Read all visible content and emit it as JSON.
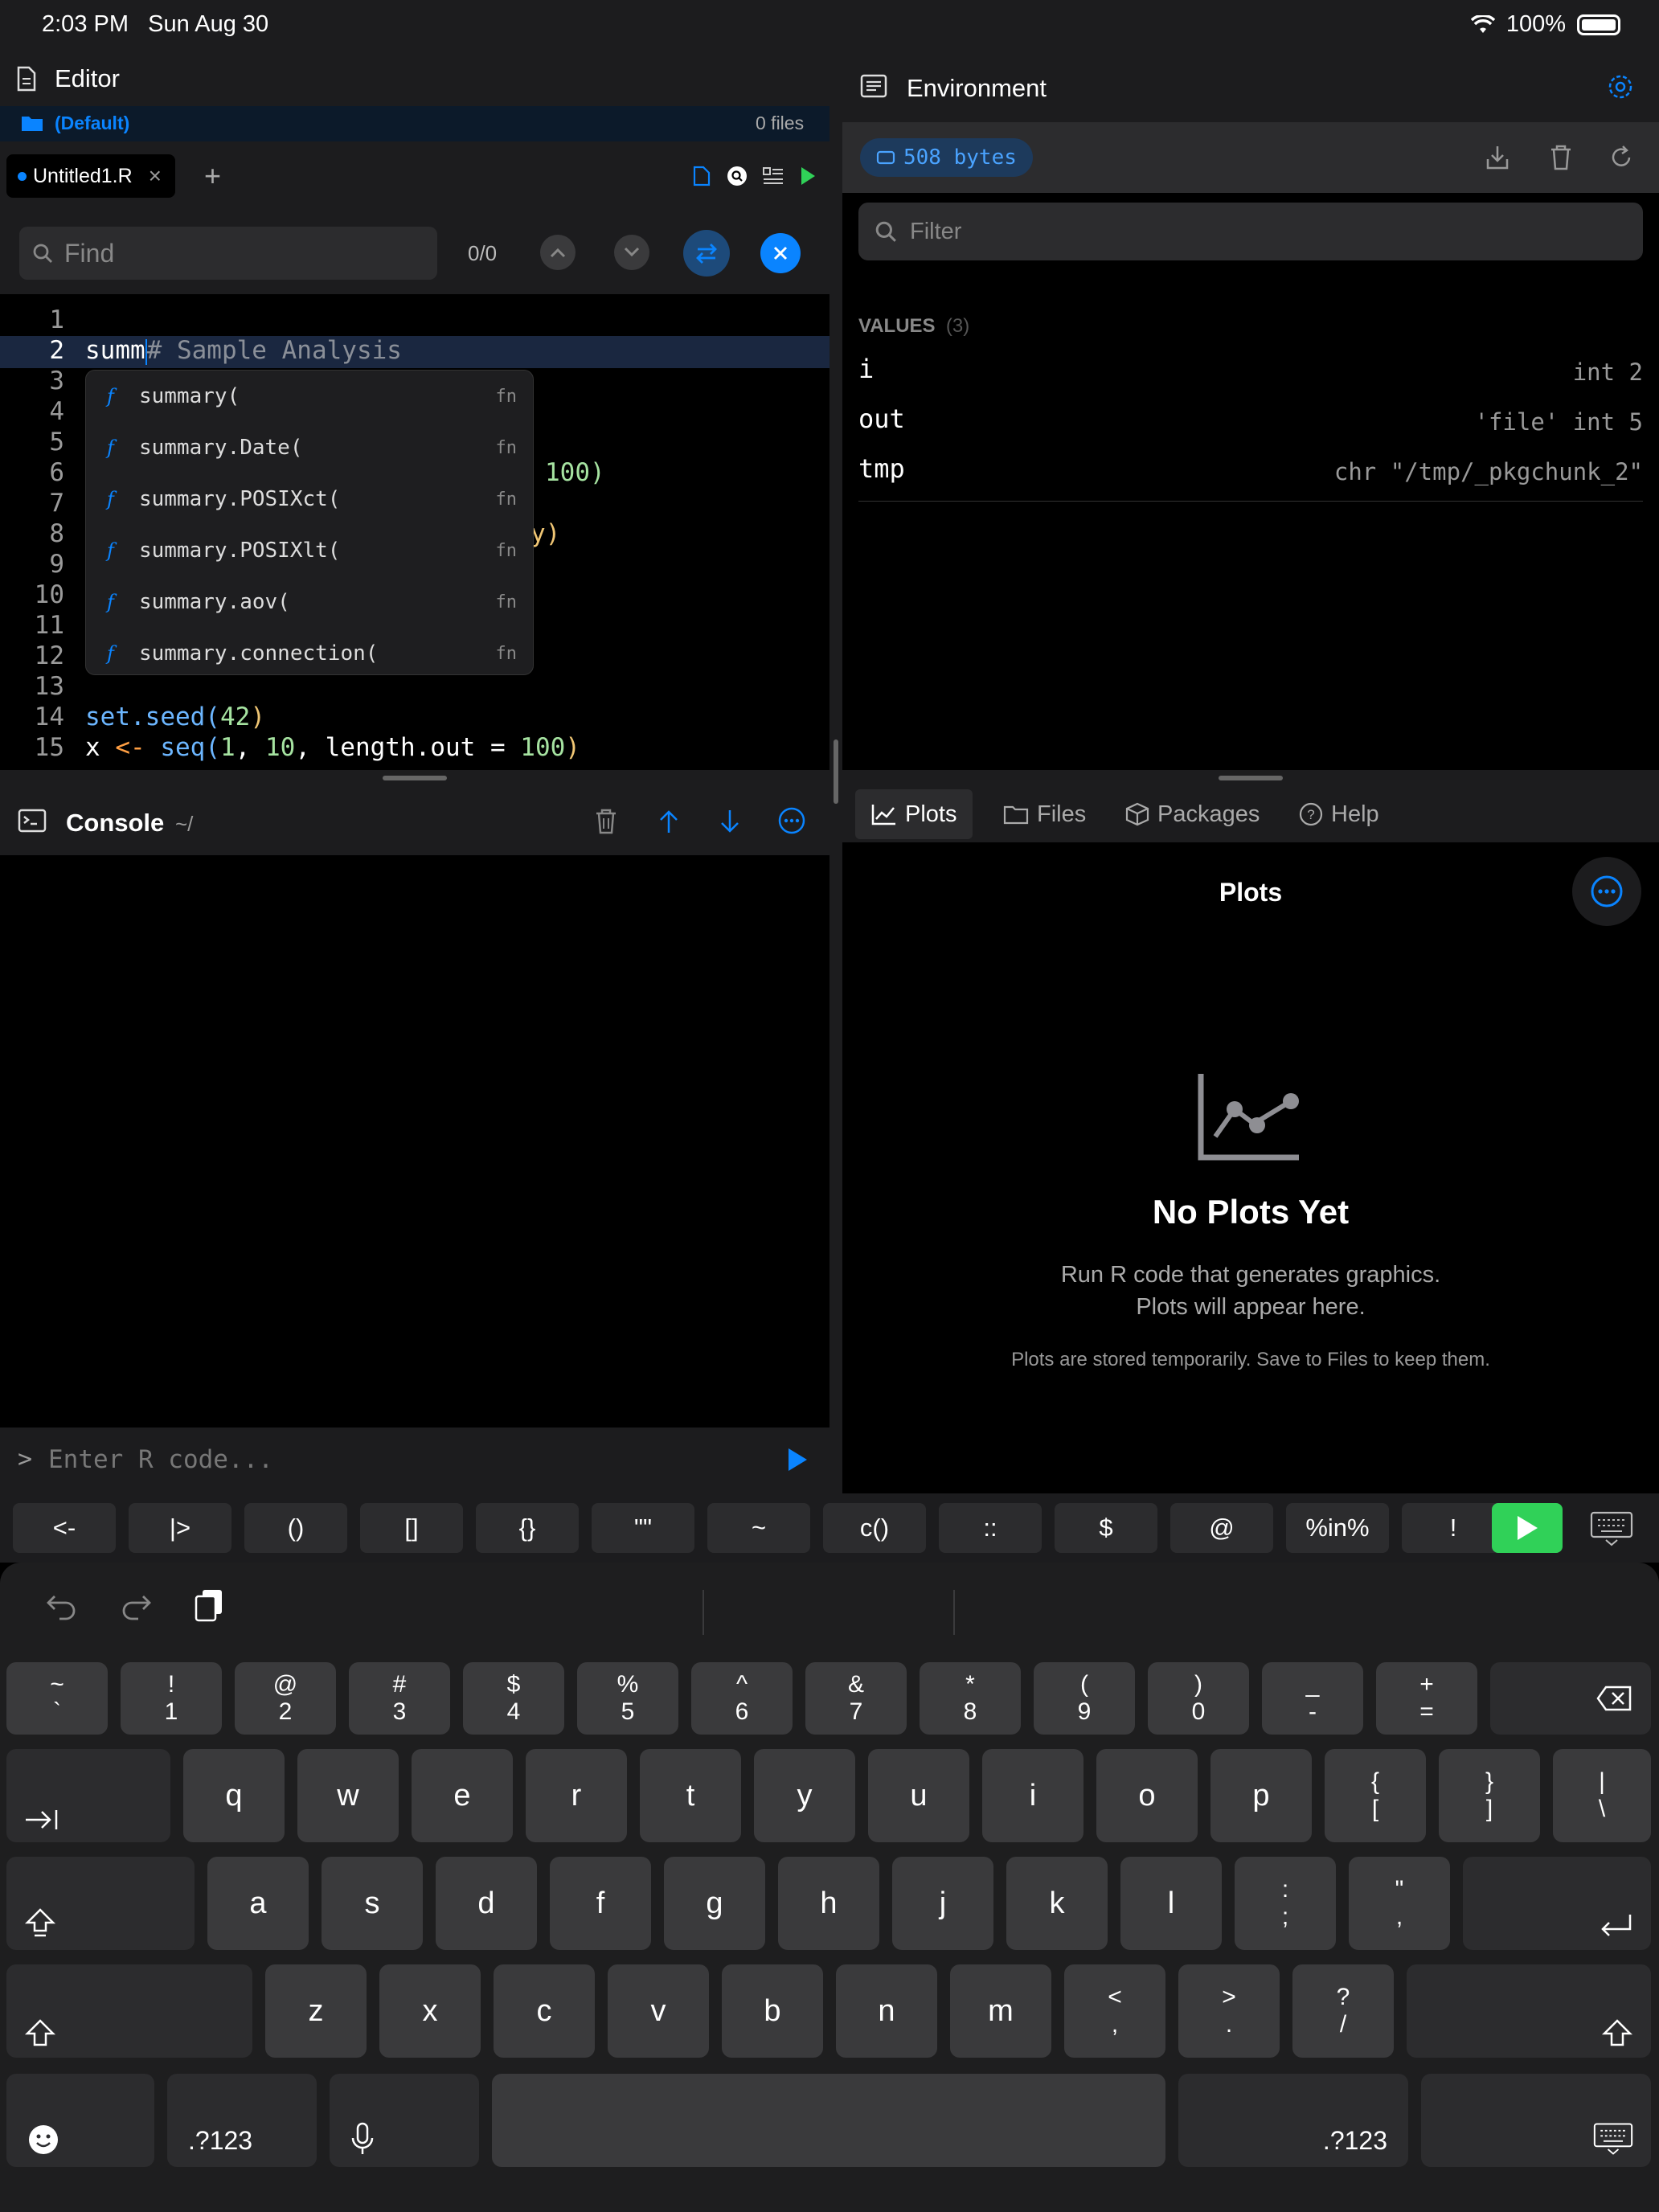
{
  "status": {
    "time": "2:03 PM",
    "date": "Sun Aug 30",
    "battery": "100%"
  },
  "editor": {
    "title": "Editor",
    "project": "(Default)",
    "files_count": "0 files",
    "tab_label": "Untitled1.R",
    "tab_close": "×",
    "add_tab": "+",
    "find_placeholder": "Find",
    "find_count": "0/0",
    "line_numbers": [
      "1",
      "2",
      "3",
      "4",
      "5",
      "6",
      "7",
      "8",
      "9",
      "10",
      "11",
      "12",
      "13",
      "14",
      "15"
    ],
    "code": {
      "line2_typed": "summ",
      "line2_comment": "# Sample Analysis",
      "line6_tail": "100)",
      "line8_tail": "y)",
      "line14_fn": "set.seed(",
      "line14_num": "42",
      "line14_close": ")",
      "line15_x": "x ",
      "line15_op": "<- ",
      "line15_fn": "seq(",
      "line15_n1": "1",
      "line15_comma": ", ",
      "line15_n2": "10",
      "line15_rest": ", length.out = ",
      "line15_n3": "100",
      "line15_close": ")"
    },
    "autocomplete": [
      {
        "label": "summary(",
        "kind": "fn"
      },
      {
        "label": "summary.Date(",
        "kind": "fn"
      },
      {
        "label": "summary.POSIXct(",
        "kind": "fn"
      },
      {
        "label": "summary.POSIXlt(",
        "kind": "fn"
      },
      {
        "label": "summary.aov(",
        "kind": "fn"
      },
      {
        "label": "summary.connection(",
        "kind": "fn"
      }
    ]
  },
  "console": {
    "title": "Console",
    "path": "~/",
    "prompt": ">",
    "placeholder": "Enter R code..."
  },
  "environment": {
    "title": "Environment",
    "size": "508 bytes",
    "filter_placeholder": "Filter",
    "section": "VALUES",
    "section_count": "(3)",
    "rows": [
      {
        "name": "i",
        "value": "int 2"
      },
      {
        "name": "out",
        "value": "'file' int 5"
      },
      {
        "name": "tmp",
        "value": "chr \"/tmp/_pkgchunk_2\""
      }
    ]
  },
  "lower_tabs": [
    "Plots",
    "Files",
    "Packages",
    "Help"
  ],
  "plots": {
    "title": "Plots",
    "empty_title": "No Plots Yet",
    "empty_line1": "Run R code that generates graphics.",
    "empty_line2": "Plots will appear here.",
    "empty_note": "Plots are stored temporarily. Save to Files to keep them."
  },
  "accessory_keys": [
    "<-",
    "|>",
    "()",
    "[]",
    "{}",
    "\"\"",
    "~",
    "c()",
    "::",
    "$",
    "@",
    "%in%",
    "!"
  ],
  "keyboard": {
    "row1": [
      {
        "top": "~",
        "bot": "`"
      },
      {
        "top": "!",
        "bot": "1"
      },
      {
        "top": "@",
        "bot": "2"
      },
      {
        "top": "#",
        "bot": "3"
      },
      {
        "top": "$",
        "bot": "4"
      },
      {
        "top": "%",
        "bot": "5"
      },
      {
        "top": "^",
        "bot": "6"
      },
      {
        "top": "&",
        "bot": "7"
      },
      {
        "top": "*",
        "bot": "8"
      },
      {
        "top": "(",
        "bot": "9"
      },
      {
        "top": ")",
        "bot": "0"
      },
      {
        "top": "_",
        "bot": "-"
      },
      {
        "top": "+",
        "bot": "="
      }
    ],
    "row2": [
      "q",
      "w",
      "e",
      "r",
      "t",
      "y",
      "u",
      "i",
      "o",
      "p"
    ],
    "row2_sym": [
      {
        "top": "{",
        "bot": "["
      },
      {
        "top": "}",
        "bot": "]"
      },
      {
        "top": "|",
        "bot": "\\"
      }
    ],
    "row3": [
      "a",
      "s",
      "d",
      "f",
      "g",
      "h",
      "j",
      "k",
      "l"
    ],
    "row3_sym": [
      {
        "top": ":",
        "bot": ";"
      },
      {
        "top": "\"",
        "bot": ","
      }
    ],
    "row4": [
      "z",
      "x",
      "c",
      "v",
      "b",
      "n",
      "m"
    ],
    "row4_sym": [
      {
        "top": "<",
        "bot": ","
      },
      {
        "top": ">",
        "bot": "."
      },
      {
        "top": "?",
        "bot": "/"
      }
    ],
    "numbers_label": ".?123"
  }
}
